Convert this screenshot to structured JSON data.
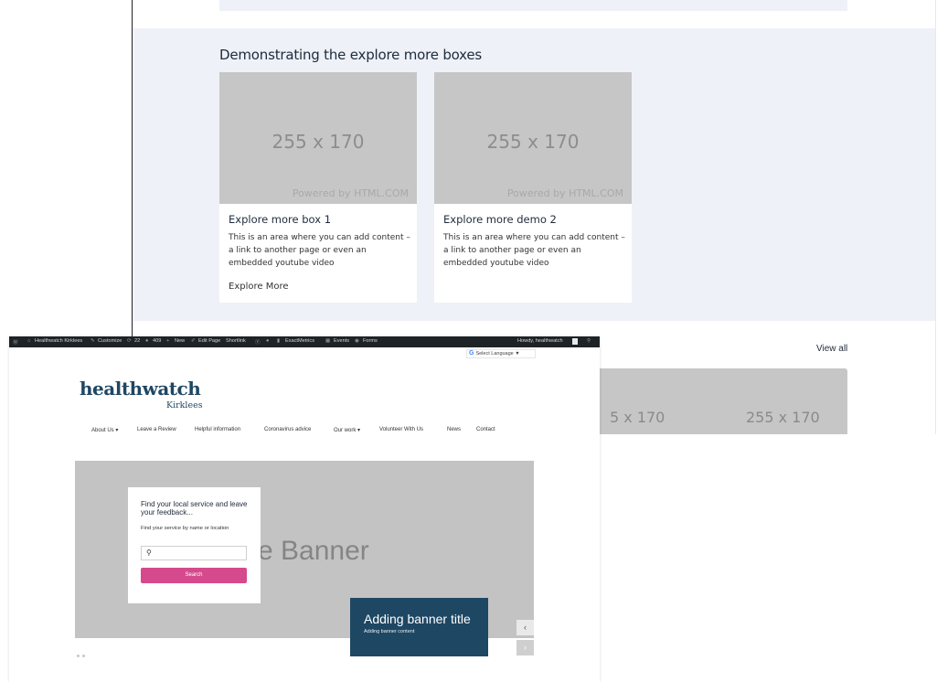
{
  "explore": {
    "heading": "Demonstrating the explore more boxes",
    "cards": [
      {
        "image_size": "255 x 170",
        "powered": "Powered by HTML.COM",
        "title": "Explore more box 1",
        "body": "This is an area where you can add content – a link to another page or even an embedded youtube video",
        "link": "Explore More"
      },
      {
        "image_size": "255 x 170",
        "powered": "Powered by HTML.COM",
        "title": "Explore more demo 2",
        "body": "This is an area where you can add content – a link to another page or even an embedded youtube video",
        "link": ""
      }
    ],
    "view_all": "View all",
    "lower_cards": [
      "5 x 170",
      "255 x 170"
    ]
  },
  "admin_bar": {
    "site": "Healthwatch Kirklees",
    "customize": "Customize",
    "updates": "22",
    "comments": "409",
    "new": "New",
    "edit_page": "Edit Page",
    "shortlink": "Shortlink",
    "exactmetrics": "ExactMetrics",
    "events": "Events",
    "forms": "Forms",
    "howdy": "Howdy, healthwatch"
  },
  "language": {
    "label": "Select Language",
    "g": "G",
    "caret": "▼"
  },
  "logo": {
    "main": "healthwatch",
    "sub": "Kirklees"
  },
  "nav": [
    "About Us ▾",
    "Leave a Review",
    "Helpful information",
    "Coronavirus advice",
    "Our work ▾",
    "Volunteer With Us",
    "News",
    "Contact"
  ],
  "banner": {
    "placeholder": "e Banner",
    "search_title": "Find your local service and leave your feedback...",
    "search_sub": "Find your service by name or location",
    "search_placeholder": "",
    "search_button": "Search",
    "title": "Adding banner title",
    "content": "Adding banner content",
    "prev": "‹",
    "next": "›"
  },
  "colors": {
    "brand_navy": "#1e4763",
    "search_pink": "#d44a8c",
    "section_bg": "#eef1f8",
    "placeholder_grey": "#c6c6c6"
  }
}
